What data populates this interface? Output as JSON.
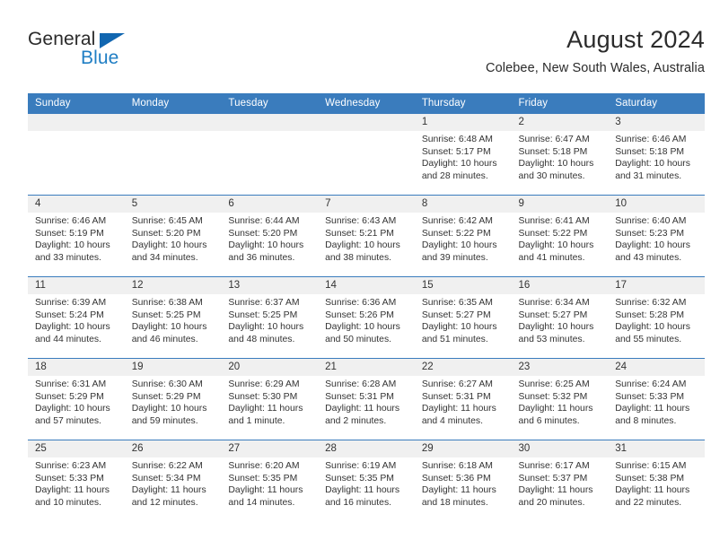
{
  "brand": {
    "name_top": "General",
    "name_bottom": "Blue",
    "triangle_color": "#1166b0",
    "blue_color": "#1f7ec4"
  },
  "header": {
    "title": "August 2024",
    "subtitle": "Colebee, New South Wales, Australia"
  },
  "theme": {
    "header_blue": "#3a7cbd",
    "daynum_band": "#f0f0f0",
    "text": "#333333"
  },
  "calendar": {
    "weekday_headers": [
      "Sunday",
      "Monday",
      "Tuesday",
      "Wednesday",
      "Thursday",
      "Friday",
      "Saturday"
    ],
    "weeks": [
      [
        {
          "day": "",
          "sunrise": "",
          "sunset": "",
          "daylight1": "",
          "daylight2": "",
          "empty": true
        },
        {
          "day": "",
          "sunrise": "",
          "sunset": "",
          "daylight1": "",
          "daylight2": "",
          "empty": true
        },
        {
          "day": "",
          "sunrise": "",
          "sunset": "",
          "daylight1": "",
          "daylight2": "",
          "empty": true
        },
        {
          "day": "",
          "sunrise": "",
          "sunset": "",
          "daylight1": "",
          "daylight2": "",
          "empty": true
        },
        {
          "day": "1",
          "sunrise": "Sunrise: 6:48 AM",
          "sunset": "Sunset: 5:17 PM",
          "daylight1": "Daylight: 10 hours",
          "daylight2": "and 28 minutes."
        },
        {
          "day": "2",
          "sunrise": "Sunrise: 6:47 AM",
          "sunset": "Sunset: 5:18 PM",
          "daylight1": "Daylight: 10 hours",
          "daylight2": "and 30 minutes."
        },
        {
          "day": "3",
          "sunrise": "Sunrise: 6:46 AM",
          "sunset": "Sunset: 5:18 PM",
          "daylight1": "Daylight: 10 hours",
          "daylight2": "and 31 minutes."
        }
      ],
      [
        {
          "day": "4",
          "sunrise": "Sunrise: 6:46 AM",
          "sunset": "Sunset: 5:19 PM",
          "daylight1": "Daylight: 10 hours",
          "daylight2": "and 33 minutes."
        },
        {
          "day": "5",
          "sunrise": "Sunrise: 6:45 AM",
          "sunset": "Sunset: 5:20 PM",
          "daylight1": "Daylight: 10 hours",
          "daylight2": "and 34 minutes."
        },
        {
          "day": "6",
          "sunrise": "Sunrise: 6:44 AM",
          "sunset": "Sunset: 5:20 PM",
          "daylight1": "Daylight: 10 hours",
          "daylight2": "and 36 minutes."
        },
        {
          "day": "7",
          "sunrise": "Sunrise: 6:43 AM",
          "sunset": "Sunset: 5:21 PM",
          "daylight1": "Daylight: 10 hours",
          "daylight2": "and 38 minutes."
        },
        {
          "day": "8",
          "sunrise": "Sunrise: 6:42 AM",
          "sunset": "Sunset: 5:22 PM",
          "daylight1": "Daylight: 10 hours",
          "daylight2": "and 39 minutes."
        },
        {
          "day": "9",
          "sunrise": "Sunrise: 6:41 AM",
          "sunset": "Sunset: 5:22 PM",
          "daylight1": "Daylight: 10 hours",
          "daylight2": "and 41 minutes."
        },
        {
          "day": "10",
          "sunrise": "Sunrise: 6:40 AM",
          "sunset": "Sunset: 5:23 PM",
          "daylight1": "Daylight: 10 hours",
          "daylight2": "and 43 minutes."
        }
      ],
      [
        {
          "day": "11",
          "sunrise": "Sunrise: 6:39 AM",
          "sunset": "Sunset: 5:24 PM",
          "daylight1": "Daylight: 10 hours",
          "daylight2": "and 44 minutes."
        },
        {
          "day": "12",
          "sunrise": "Sunrise: 6:38 AM",
          "sunset": "Sunset: 5:25 PM",
          "daylight1": "Daylight: 10 hours",
          "daylight2": "and 46 minutes."
        },
        {
          "day": "13",
          "sunrise": "Sunrise: 6:37 AM",
          "sunset": "Sunset: 5:25 PM",
          "daylight1": "Daylight: 10 hours",
          "daylight2": "and 48 minutes."
        },
        {
          "day": "14",
          "sunrise": "Sunrise: 6:36 AM",
          "sunset": "Sunset: 5:26 PM",
          "daylight1": "Daylight: 10 hours",
          "daylight2": "and 50 minutes."
        },
        {
          "day": "15",
          "sunrise": "Sunrise: 6:35 AM",
          "sunset": "Sunset: 5:27 PM",
          "daylight1": "Daylight: 10 hours",
          "daylight2": "and 51 minutes."
        },
        {
          "day": "16",
          "sunrise": "Sunrise: 6:34 AM",
          "sunset": "Sunset: 5:27 PM",
          "daylight1": "Daylight: 10 hours",
          "daylight2": "and 53 minutes."
        },
        {
          "day": "17",
          "sunrise": "Sunrise: 6:32 AM",
          "sunset": "Sunset: 5:28 PM",
          "daylight1": "Daylight: 10 hours",
          "daylight2": "and 55 minutes."
        }
      ],
      [
        {
          "day": "18",
          "sunrise": "Sunrise: 6:31 AM",
          "sunset": "Sunset: 5:29 PM",
          "daylight1": "Daylight: 10 hours",
          "daylight2": "and 57 minutes."
        },
        {
          "day": "19",
          "sunrise": "Sunrise: 6:30 AM",
          "sunset": "Sunset: 5:29 PM",
          "daylight1": "Daylight: 10 hours",
          "daylight2": "and 59 minutes."
        },
        {
          "day": "20",
          "sunrise": "Sunrise: 6:29 AM",
          "sunset": "Sunset: 5:30 PM",
          "daylight1": "Daylight: 11 hours",
          "daylight2": "and 1 minute."
        },
        {
          "day": "21",
          "sunrise": "Sunrise: 6:28 AM",
          "sunset": "Sunset: 5:31 PM",
          "daylight1": "Daylight: 11 hours",
          "daylight2": "and 2 minutes."
        },
        {
          "day": "22",
          "sunrise": "Sunrise: 6:27 AM",
          "sunset": "Sunset: 5:31 PM",
          "daylight1": "Daylight: 11 hours",
          "daylight2": "and 4 minutes."
        },
        {
          "day": "23",
          "sunrise": "Sunrise: 6:25 AM",
          "sunset": "Sunset: 5:32 PM",
          "daylight1": "Daylight: 11 hours",
          "daylight2": "and 6 minutes."
        },
        {
          "day": "24",
          "sunrise": "Sunrise: 6:24 AM",
          "sunset": "Sunset: 5:33 PM",
          "daylight1": "Daylight: 11 hours",
          "daylight2": "and 8 minutes."
        }
      ],
      [
        {
          "day": "25",
          "sunrise": "Sunrise: 6:23 AM",
          "sunset": "Sunset: 5:33 PM",
          "daylight1": "Daylight: 11 hours",
          "daylight2": "and 10 minutes."
        },
        {
          "day": "26",
          "sunrise": "Sunrise: 6:22 AM",
          "sunset": "Sunset: 5:34 PM",
          "daylight1": "Daylight: 11 hours",
          "daylight2": "and 12 minutes."
        },
        {
          "day": "27",
          "sunrise": "Sunrise: 6:20 AM",
          "sunset": "Sunset: 5:35 PM",
          "daylight1": "Daylight: 11 hours",
          "daylight2": "and 14 minutes."
        },
        {
          "day": "28",
          "sunrise": "Sunrise: 6:19 AM",
          "sunset": "Sunset: 5:35 PM",
          "daylight1": "Daylight: 11 hours",
          "daylight2": "and 16 minutes."
        },
        {
          "day": "29",
          "sunrise": "Sunrise: 6:18 AM",
          "sunset": "Sunset: 5:36 PM",
          "daylight1": "Daylight: 11 hours",
          "daylight2": "and 18 minutes."
        },
        {
          "day": "30",
          "sunrise": "Sunrise: 6:17 AM",
          "sunset": "Sunset: 5:37 PM",
          "daylight1": "Daylight: 11 hours",
          "daylight2": "and 20 minutes."
        },
        {
          "day": "31",
          "sunrise": "Sunrise: 6:15 AM",
          "sunset": "Sunset: 5:38 PM",
          "daylight1": "Daylight: 11 hours",
          "daylight2": "and 22 minutes."
        }
      ]
    ]
  }
}
